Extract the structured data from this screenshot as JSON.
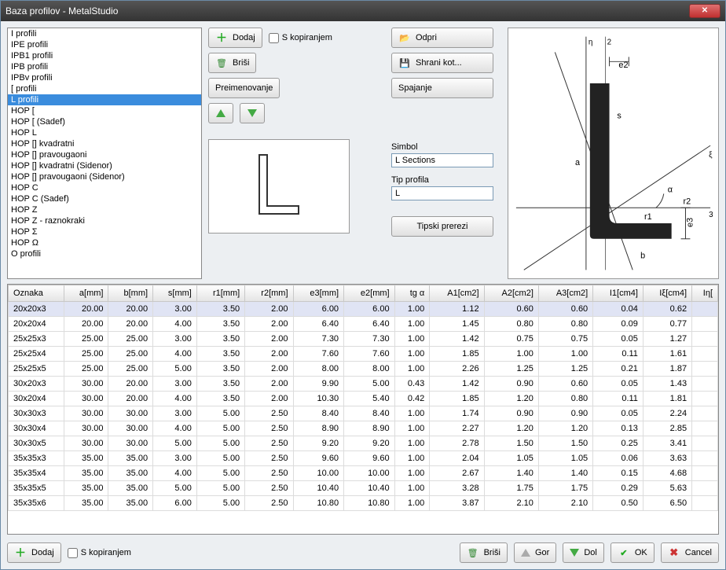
{
  "window": {
    "title": "Baza profilov - MetalStudio"
  },
  "profile_list": [
    "I profili",
    "IPE profili",
    "IPB1 profili",
    "IPB profili",
    "IPBv profili",
    "[ profili",
    "L profili",
    "HOP [",
    "HOP [ (Sadef)",
    "HOP L",
    "HOP [] kvadratni",
    "HOP [] pravougaoni",
    "HOP [] kvadratni (Sidenor)",
    "HOP [] pravougaoni (Sidenor)",
    "HOP C",
    "HOP C (Sadef)",
    "HOP Z",
    "HOP Z - raznokraki",
    "HOP Σ",
    "HOP Ω",
    "O profili"
  ],
  "profile_selected_index": 6,
  "buttons": {
    "add": "Dodaj",
    "delete": "Briši",
    "rename": "Preimenovanje",
    "open": "Odpri",
    "save_as": "Shrani kot...",
    "merge": "Spajanje",
    "typical": "Tipski prerezi",
    "copy_check": "S kopiranjem",
    "up_label": "Gor",
    "down_label": "Dol",
    "ok": "OK",
    "cancel": "Cancel"
  },
  "fields": {
    "symbol_label": "Simbol",
    "symbol_value": "L Sections",
    "type_label": "Tip profila",
    "type_value": "L"
  },
  "table": {
    "columns": [
      "Oznaka",
      "a[mm]",
      "b[mm]",
      "s[mm]",
      "r1[mm]",
      "r2[mm]",
      "e3[mm]",
      "e2[mm]",
      "tg α",
      "A1[cm2]",
      "A2[cm2]",
      "A3[cm2]",
      "I1[cm4]",
      "Iξ[cm4]",
      "Iη["
    ],
    "rows": [
      [
        "20x20x3",
        "20.00",
        "20.00",
        "3.00",
        "3.50",
        "2.00",
        "6.00",
        "6.00",
        "1.00",
        "1.12",
        "0.60",
        "0.60",
        "0.04",
        "0.62",
        ""
      ],
      [
        "20x20x4",
        "20.00",
        "20.00",
        "4.00",
        "3.50",
        "2.00",
        "6.40",
        "6.40",
        "1.00",
        "1.45",
        "0.80",
        "0.80",
        "0.09",
        "0.77",
        ""
      ],
      [
        "25x25x3",
        "25.00",
        "25.00",
        "3.00",
        "3.50",
        "2.00",
        "7.30",
        "7.30",
        "1.00",
        "1.42",
        "0.75",
        "0.75",
        "0.05",
        "1.27",
        ""
      ],
      [
        "25x25x4",
        "25.00",
        "25.00",
        "4.00",
        "3.50",
        "2.00",
        "7.60",
        "7.60",
        "1.00",
        "1.85",
        "1.00",
        "1.00",
        "0.11",
        "1.61",
        ""
      ],
      [
        "25x25x5",
        "25.00",
        "25.00",
        "5.00",
        "3.50",
        "2.00",
        "8.00",
        "8.00",
        "1.00",
        "2.26",
        "1.25",
        "1.25",
        "0.21",
        "1.87",
        ""
      ],
      [
        "30x20x3",
        "30.00",
        "20.00",
        "3.00",
        "3.50",
        "2.00",
        "9.90",
        "5.00",
        "0.43",
        "1.42",
        "0.90",
        "0.60",
        "0.05",
        "1.43",
        ""
      ],
      [
        "30x20x4",
        "30.00",
        "20.00",
        "4.00",
        "3.50",
        "2.00",
        "10.30",
        "5.40",
        "0.42",
        "1.85",
        "1.20",
        "0.80",
        "0.11",
        "1.81",
        ""
      ],
      [
        "30x30x3",
        "30.00",
        "30.00",
        "3.00",
        "5.00",
        "2.50",
        "8.40",
        "8.40",
        "1.00",
        "1.74",
        "0.90",
        "0.90",
        "0.05",
        "2.24",
        ""
      ],
      [
        "30x30x4",
        "30.00",
        "30.00",
        "4.00",
        "5.00",
        "2.50",
        "8.90",
        "8.90",
        "1.00",
        "2.27",
        "1.20",
        "1.20",
        "0.13",
        "2.85",
        ""
      ],
      [
        "30x30x5",
        "30.00",
        "30.00",
        "5.00",
        "5.00",
        "2.50",
        "9.20",
        "9.20",
        "1.00",
        "2.78",
        "1.50",
        "1.50",
        "0.25",
        "3.41",
        ""
      ],
      [
        "35x35x3",
        "35.00",
        "35.00",
        "3.00",
        "5.00",
        "2.50",
        "9.60",
        "9.60",
        "1.00",
        "2.04",
        "1.05",
        "1.05",
        "0.06",
        "3.63",
        ""
      ],
      [
        "35x35x4",
        "35.00",
        "35.00",
        "4.00",
        "5.00",
        "2.50",
        "10.00",
        "10.00",
        "1.00",
        "2.67",
        "1.40",
        "1.40",
        "0.15",
        "4.68",
        ""
      ],
      [
        "35x35x5",
        "35.00",
        "35.00",
        "5.00",
        "5.00",
        "2.50",
        "10.40",
        "10.40",
        "1.00",
        "3.28",
        "1.75",
        "1.75",
        "0.29",
        "5.63",
        ""
      ],
      [
        "35x35x6",
        "35.00",
        "35.00",
        "6.00",
        "5.00",
        "2.50",
        "10.80",
        "10.80",
        "1.00",
        "3.87",
        "2.10",
        "2.10",
        "0.50",
        "6.50",
        ""
      ]
    ],
    "selected_row": 0
  }
}
